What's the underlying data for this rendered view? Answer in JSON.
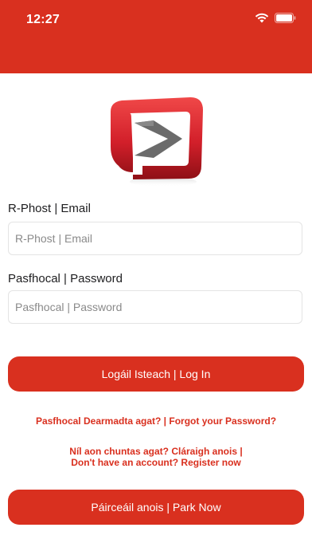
{
  "status_bar": {
    "time": "12:27"
  },
  "login": {
    "email_label": "R-Phost | Email",
    "email_placeholder": "R-Phost | Email",
    "password_label": "Pasfhocal | Password",
    "password_placeholder": "Pasfhocal | Password",
    "login_button": "Logáil Isteach | Log In",
    "forgot_password": "Pasfhocal Dearmadta agat? | Forgot your Password?",
    "register_line1": "Níl aon chuntas agat? Cláraigh anois  |",
    "register_line2": "Don't have an account? Register now",
    "park_now_button": "Páirceáil anois | Park Now"
  },
  "colors": {
    "accent": "#d9301f"
  },
  "icons": [
    "wifi-icon",
    "battery-icon",
    "app-logo"
  ]
}
